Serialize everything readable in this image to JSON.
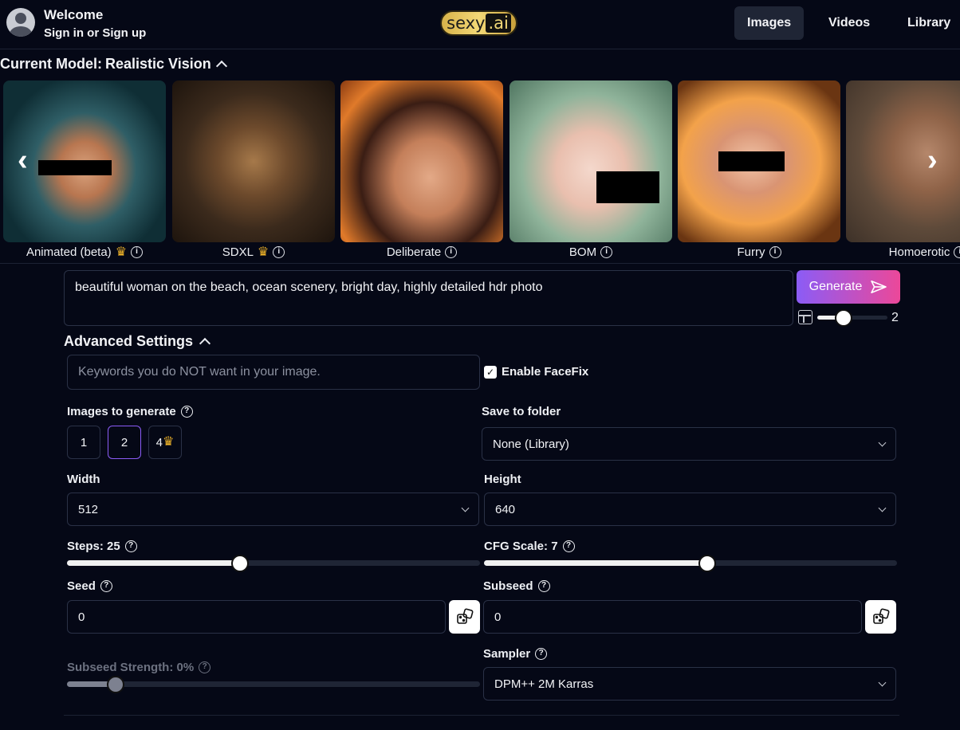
{
  "header": {
    "welcome": "Welcome",
    "signin": "Sign in or Sign up",
    "logo_word": "sexy",
    "logo_suffix": ".ai",
    "nav": [
      {
        "label": "Images",
        "active": true
      },
      {
        "label": "Videos",
        "active": false
      },
      {
        "label": "Library",
        "active": false
      }
    ]
  },
  "models": {
    "current_prefix": "Current Model:",
    "current_name": "Realistic Vision",
    "items": [
      {
        "label": "Animated (beta)",
        "premium": true,
        "icon": "crown-icon"
      },
      {
        "label": "SDXL",
        "premium": true,
        "icon": "crown-icon"
      },
      {
        "label": "Deliberate",
        "premium": false
      },
      {
        "label": "BOM",
        "premium": false
      },
      {
        "label": "Furry",
        "premium": false
      },
      {
        "label": "Homoerotic",
        "premium": false
      }
    ]
  },
  "prompt": {
    "text": "beautiful woman on the beach, ocean scenery, bright day, highly detailed hdr photo",
    "generate_label": "Generate",
    "batch_value": "2"
  },
  "advanced": {
    "title": "Advanced Settings",
    "negative_placeholder": "Keywords you do NOT want in your image.",
    "facefix_label": "Enable FaceFix",
    "facefix_checked": true,
    "images_label": "Images to generate",
    "image_counts": [
      "1",
      "2",
      "4"
    ],
    "selected_count": "2",
    "folder_label": "Save to folder",
    "folder_value": "None (Library)",
    "width_label": "Width",
    "width_value": "512",
    "height_label": "Height",
    "height_value": "640",
    "steps_label": "Steps: 25",
    "steps_value": 25,
    "cfg_label": "CFG Scale: 7",
    "cfg_value": 7,
    "seed_label": "Seed",
    "seed_value": "0",
    "subseed_label": "Subseed",
    "subseed_value": "0",
    "subseed_strength_label": "Subseed Strength: 0%",
    "subseed_strength_value": 0,
    "sampler_label": "Sampler",
    "sampler_value": "DPM++ 2M Karras"
  }
}
